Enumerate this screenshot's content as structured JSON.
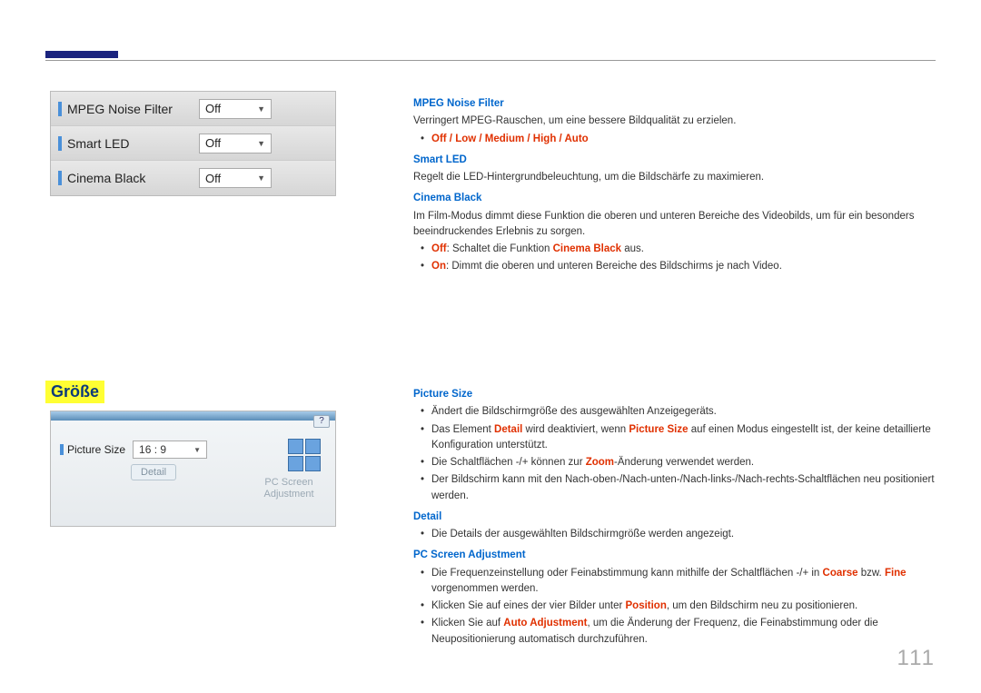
{
  "page_number": "111",
  "section_heading": "Größe",
  "fig1": {
    "rows": [
      {
        "label": "MPEG Noise Filter",
        "value": "Off"
      },
      {
        "label": "Smart LED",
        "value": "Off"
      },
      {
        "label": "Cinema Black",
        "value": "Off"
      }
    ]
  },
  "fig2": {
    "help": "?",
    "picture_size_label": "Picture Size",
    "picture_size_value": "16 : 9",
    "detail_label": "Detail",
    "psc_label": "PC Screen Adjustment"
  },
  "right1": {
    "mpeg_title": "MPEG Noise Filter",
    "mpeg_desc": "Verringert MPEG-Rauschen, um eine bessere Bildqualität zu erzielen.",
    "mpeg_opts": "Off / Low / Medium / High / Auto",
    "smart_title": "Smart LED",
    "smart_desc": "Regelt die LED-Hintergrundbeleuchtung, um die Bildschärfe zu maximieren.",
    "cinema_title": "Cinema Black",
    "cinema_desc": "Im Film-Modus dimmt diese Funktion die oberen und unteren Bereiche des Videobilds, um für ein besonders beeindruckendes Erlebnis zu sorgen.",
    "cinema_off_k": "Off",
    "cinema_off_t": ": Schaltet die Funktion ",
    "cinema_off_k2": "Cinema Black",
    "cinema_off_t2": " aus.",
    "cinema_on_k": "On",
    "cinema_on_t": ": Dimmt die oberen und unteren Bereiche des Bildschirms je nach Video."
  },
  "right2": {
    "ps_title": "Picture Size",
    "ps1": "Ändert die Bildschirmgröße des ausgewählten Anzeigegeräts.",
    "ps2a": "Das Element ",
    "ps2k1": "Detail",
    "ps2b": " wird deaktiviert, wenn ",
    "ps2k2": "Picture Size",
    "ps2c": " auf einen Modus eingestellt ist, der keine detaillierte Konfiguration unterstützt.",
    "ps3a": "Die Schaltflächen -/+ können zur ",
    "ps3k": "Zoom",
    "ps3b": "-Änderung verwendet werden.",
    "ps4": "Der Bildschirm kann mit den Nach-oben-/Nach-unten-/Nach-links-/Nach-rechts-Schaltflächen neu positioniert werden.",
    "detail_title": "Detail",
    "detail1": "Die Details der ausgewählten Bildschirmgröße werden angezeigt.",
    "pcs_title": "PC Screen Adjustment",
    "pcs1a": "Die Frequenzeinstellung oder Feinabstimmung kann mithilfe der Schaltflächen -/+ in ",
    "pcs1k1": "Coarse",
    "pcs1b": " bzw. ",
    "pcs1k2": "Fine",
    "pcs1c": " vorgenommen werden.",
    "pcs2a": "Klicken Sie auf eines der vier Bilder unter ",
    "pcs2k": "Position",
    "pcs2b": ", um den Bildschirm neu zu positionieren.",
    "pcs3a": "Klicken Sie auf ",
    "pcs3k": "Auto Adjustment",
    "pcs3b": ", um die Änderung der Frequenz, die Feinabstimmung oder die Neupositionierung automatisch durchzuführen."
  }
}
